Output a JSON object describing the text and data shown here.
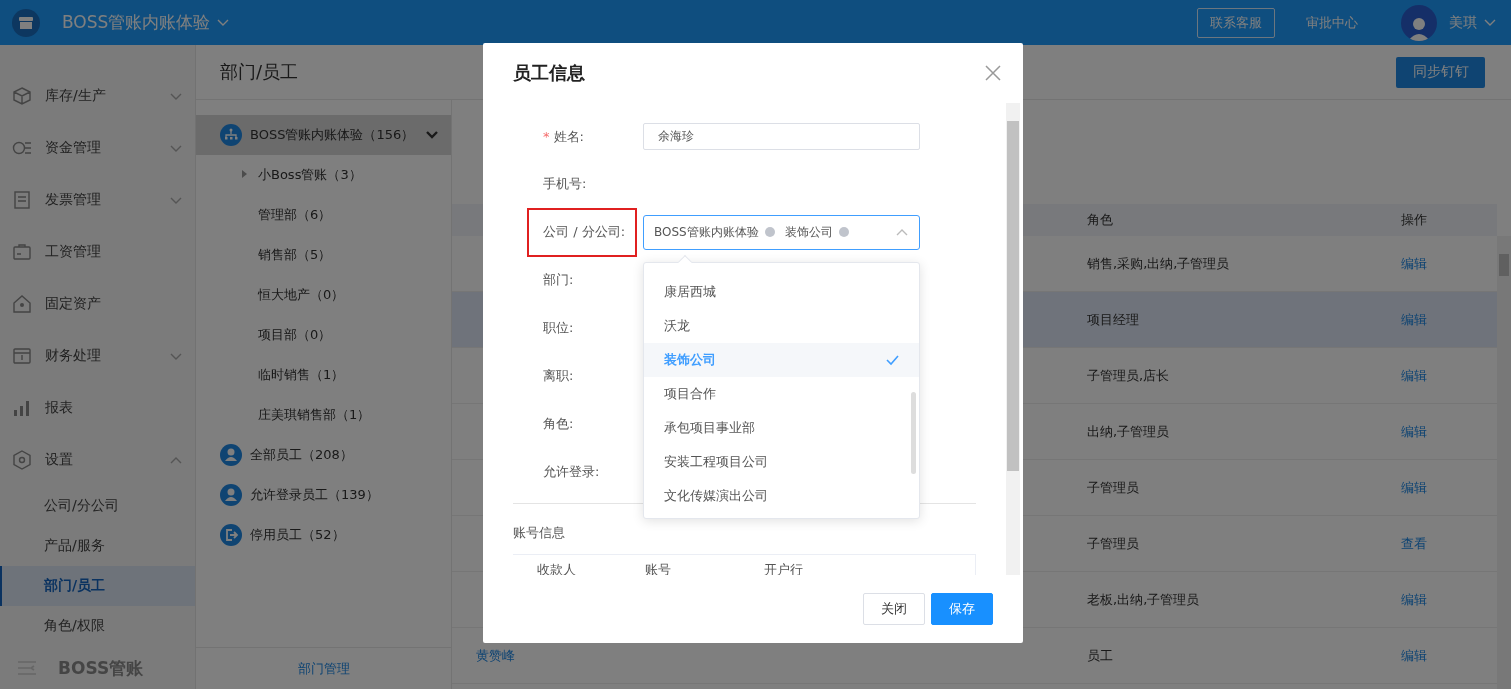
{
  "header": {
    "app_title": "BOSS管账内账体验",
    "links": [
      {
        "label": "联系客服",
        "kind": "outlined"
      },
      {
        "label": "审批中心",
        "kind": "plain"
      }
    ],
    "user_name": "美琪"
  },
  "sidebar": {
    "items": [
      {
        "label": "库存/生产",
        "expanded": false
      },
      {
        "label": "资金管理",
        "expanded": false
      },
      {
        "label": "发票管理",
        "expanded": false
      },
      {
        "label": "工资管理"
      },
      {
        "label": "固定资产"
      },
      {
        "label": "财务处理",
        "expanded": false
      },
      {
        "label": "报表"
      },
      {
        "label": "设置",
        "expanded": true,
        "children": [
          {
            "label": "公司/分公司",
            "selected": false
          },
          {
            "label": "产品/服务",
            "selected": false
          },
          {
            "label": "部门/员工",
            "selected": true
          },
          {
            "label": "角色/权限",
            "selected": false
          }
        ]
      }
    ],
    "footer": "BOSS管账"
  },
  "page_title": "部门/员工",
  "sync_button": "同步钉钉",
  "dept_tree": {
    "root": {
      "label": "BOSS管账内账体验（156）",
      "expanded": true,
      "selected": true,
      "children": [
        {
          "label": "小Boss管账（3）",
          "expanded": false,
          "selected": false
        },
        {
          "label": "管理部（6）",
          "selected": false
        },
        {
          "label": "销售部（5）",
          "selected": false
        },
        {
          "label": "恒大地产（0）",
          "selected": false
        },
        {
          "label": "项目部（0）",
          "selected": false
        },
        {
          "label": "临时销售（1）",
          "selected": false
        },
        {
          "label": "庄美琪销售部（1）",
          "selected": false
        }
      ]
    },
    "groups": [
      {
        "label": "全部员工（208）",
        "kind": "person",
        "selected": false
      },
      {
        "label": "允许登录员工（139）",
        "kind": "person",
        "selected": false
      },
      {
        "label": "停用员工（52）",
        "kind": "exit",
        "selected": false
      }
    ],
    "footer": "部门管理"
  },
  "table": {
    "columns": [
      "角色",
      "操作"
    ],
    "rows": [
      {
        "role": "销售,采购,出纳,子管理员",
        "action": "编辑",
        "selected": false
      },
      {
        "role": "项目经理",
        "action": "编辑",
        "selected": true
      },
      {
        "role": "子管理员,店长",
        "action": "编辑",
        "selected": false
      },
      {
        "role": "出纳,子管理员",
        "action": "编辑",
        "selected": false
      },
      {
        "role": "子管理员",
        "action": "编辑",
        "selected": false
      },
      {
        "role": "子管理员",
        "action": "查看",
        "selected": false
      },
      {
        "role": "老板,出纳,子管理员",
        "action": "编辑",
        "selected": false
      },
      {
        "name": "黄赞峰",
        "role": "员工",
        "action": "编辑",
        "selected": false
      }
    ]
  },
  "dialog": {
    "title": "员工信息",
    "fields": [
      {
        "label": "姓名:",
        "required_mark": "*",
        "kind": "text",
        "value": "余海珍"
      },
      {
        "label": "手机号:",
        "kind": "plain"
      },
      {
        "label": "公司 / 分公司:",
        "kind": "select",
        "highlighted": true,
        "tags": [
          "BOSS管账内账体验",
          "装饰公司"
        ],
        "open": true
      },
      {
        "label": "部门:",
        "kind": "plain"
      },
      {
        "label": "职位:",
        "kind": "plain"
      },
      {
        "label": "离职:",
        "kind": "plain"
      },
      {
        "label": "角色:",
        "kind": "plain"
      },
      {
        "label": "允许登录:",
        "kind": "plain"
      }
    ],
    "dropdown_options": [
      {
        "label": "康居西城",
        "selected": false
      },
      {
        "label": "沃龙",
        "selected": false
      },
      {
        "label": "装饰公司",
        "selected": true
      },
      {
        "label": "项目合作",
        "selected": false
      },
      {
        "label": "承包项目事业部",
        "selected": false
      },
      {
        "label": "安装工程项目公司",
        "selected": false
      },
      {
        "label": "文化传媒演出公司",
        "selected": false
      }
    ],
    "account_section": {
      "title": "账号信息",
      "columns": [
        "收款人",
        "账号",
        "开户行"
      ]
    },
    "buttons": [
      {
        "label": "关闭",
        "kind": "default"
      },
      {
        "label": "保存",
        "kind": "primary"
      }
    ]
  }
}
